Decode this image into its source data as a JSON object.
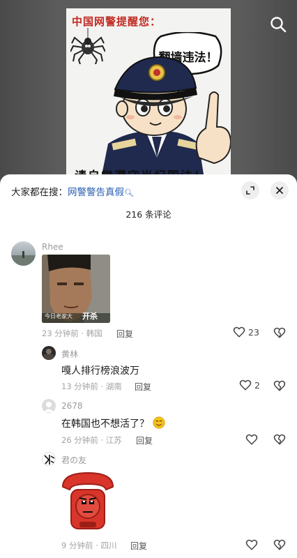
{
  "video": {
    "poster_title": "中国网警提醒您：",
    "bubble_text": "翻墙违法！",
    "bottom_text": "请自觉遵守当纪国法！",
    "search_icon": "search-icon"
  },
  "panel": {
    "trending_prefix": "大家都在搜：",
    "trending_keyword": "网警警告真假",
    "comment_count": "216 条评论"
  },
  "comments": [
    {
      "user": "Rhee",
      "gif_caption": "开杀",
      "gif_caption_small": "今日老家大",
      "time_loc": "23 分钟前 · 韩国",
      "reply_label": "回复",
      "likes": "23"
    },
    {
      "user": "黄林",
      "text": "嘎人排行榜浪波万",
      "time_loc": "13 分钟前 · 湖南",
      "reply_label": "回复",
      "likes": "2"
    },
    {
      "user": "2678",
      "text": "在韩国也不想活了？",
      "time_loc": "26 分钟前 · 江苏",
      "reply_label": "回复",
      "likes": ""
    },
    {
      "user": "君の友",
      "time_loc": "9 分钟前 · 四川",
      "reply_label": "回复",
      "likes": ""
    }
  ],
  "colors": {
    "link": "#2a5db0",
    "phone_red": "#d9352a"
  }
}
